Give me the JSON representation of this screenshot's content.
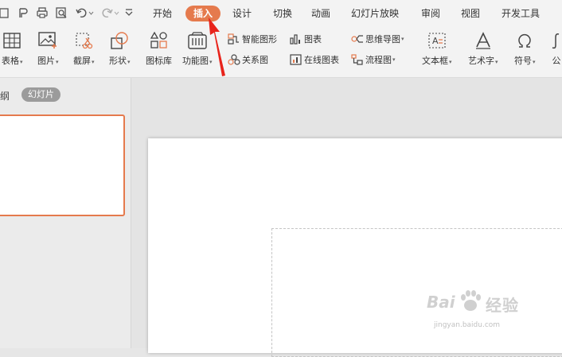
{
  "menubar": {
    "tabs": [
      "开始",
      "插入",
      "设计",
      "切换",
      "动画",
      "幻灯片放映",
      "审阅",
      "视图",
      "开发工具"
    ],
    "active_tab": "插入"
  },
  "ribbon": {
    "big_buttons": [
      "表格",
      "图片",
      "截屏",
      "形状",
      "图标库",
      "功能图"
    ],
    "small_buttons": [
      "智能图形",
      "图表",
      "思维导图",
      "关系图",
      "在线图表",
      "流程图"
    ],
    "right_buttons": [
      "文本框",
      "艺术字",
      "符号",
      "公"
    ]
  },
  "sidebar": {
    "outline_label": "纲",
    "slides_label": "幻灯片"
  },
  "watermark": {
    "brand": "Bai",
    "text": "经验",
    "url": "jingyan.baidu.com"
  },
  "colors": {
    "accent": "#e57a4d",
    "annotation_arrow": "#e8231b"
  }
}
